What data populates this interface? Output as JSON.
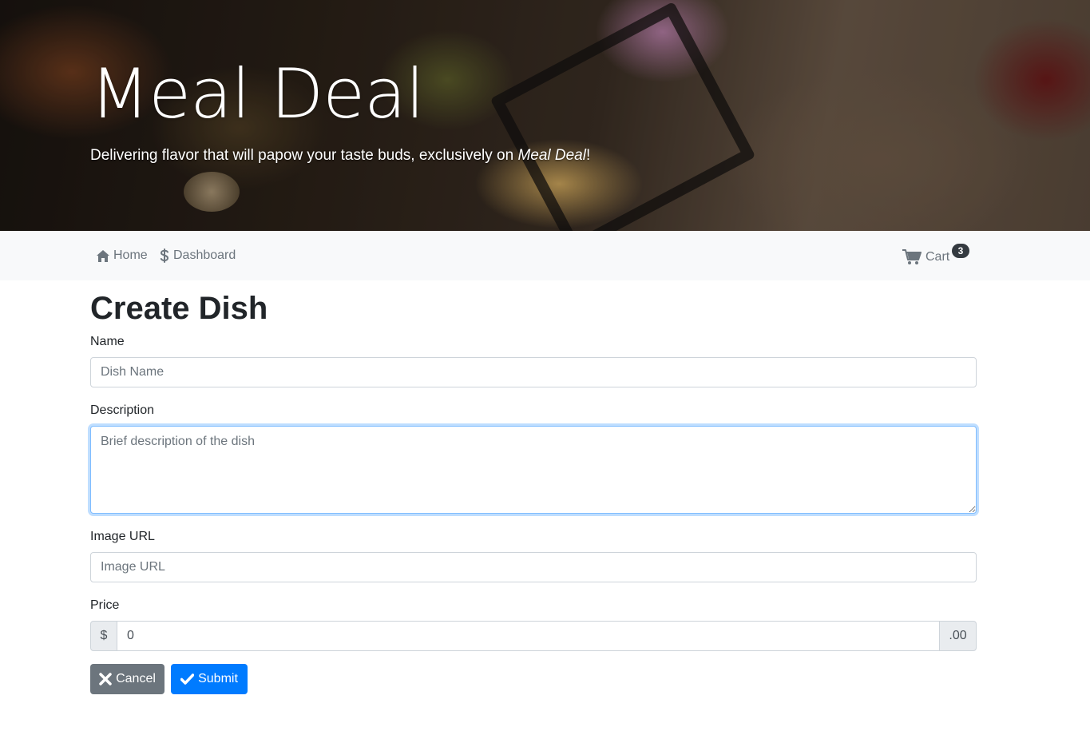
{
  "hero": {
    "title": "Meal Deal",
    "tagline_prefix": "Delivering flavor that will papow your taste buds, exclusively on ",
    "tagline_brand": "Meal Deal",
    "tagline_suffix": "!"
  },
  "navbar": {
    "home_label": "Home",
    "home_icon": "home-icon",
    "dashboard_label": "Dashboard",
    "dashboard_icon": "dollar-icon",
    "cart_label": "Cart",
    "cart_icon": "cart-icon",
    "cart_count": "3"
  },
  "form": {
    "title": "Create Dish",
    "name": {
      "label": "Name",
      "placeholder": "Dish Name",
      "value": ""
    },
    "description": {
      "label": "Description",
      "placeholder": "Brief description of the dish",
      "value": ""
    },
    "image_url": {
      "label": "Image URL",
      "placeholder": "Image URL",
      "value": ""
    },
    "price": {
      "label": "Price",
      "prefix": "$",
      "value": "0",
      "suffix": ".00"
    },
    "cancel_label": "Cancel",
    "cancel_icon": "close-icon",
    "submit_label": "Submit",
    "submit_icon": "check-icon"
  },
  "colors": {
    "primary": "#007bff",
    "secondary": "#6c757d",
    "navbar_bg": "#f8f9fa",
    "badge_bg": "#343a40"
  }
}
